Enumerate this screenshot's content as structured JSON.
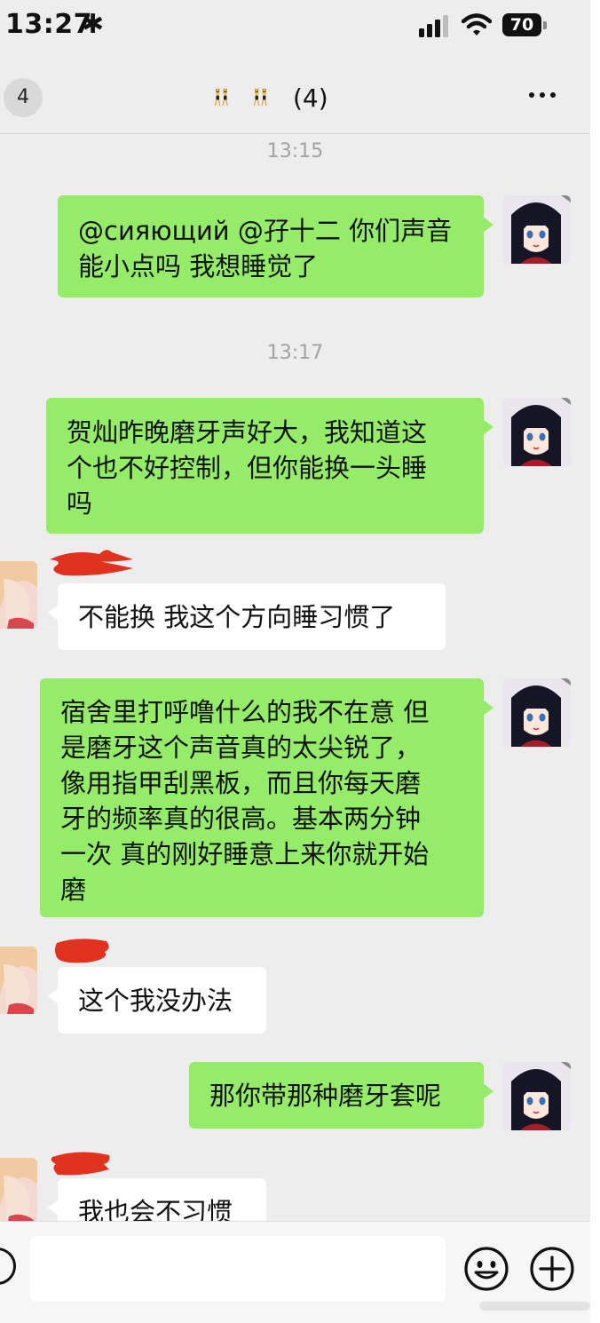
{
  "status_bar": {
    "time": "13:27",
    "battery": "70"
  },
  "nav": {
    "badge": "4",
    "title_count": "(4)"
  },
  "messages": [
    {
      "sender": "me",
      "lines": [
        "@сияющий @孖十二 你们声音",
        "能小点吗 我想睡觉了"
      ]
    },
    {
      "sender": "me",
      "lines": [
        "贺灿昨晚磨牙声好大，我知道这",
        "个也不好控制，但你能换一头睡",
        "吗"
      ]
    },
    {
      "sender": "other",
      "lines": [
        "不能换 我这个方向睡习惯了"
      ]
    },
    {
      "sender": "me",
      "lines": [
        "宿舍里打呼噜什么的我不在意 但",
        "是磨牙这个声音真的太尖锐了，",
        "像用指甲刮黑板，而且你每天磨",
        "牙的频率真的很高。基本两分钟",
        "一次 真的刚好睡意上来你就开始",
        "磨"
      ]
    },
    {
      "sender": "other",
      "lines": [
        "这个我没办法"
      ]
    },
    {
      "sender": "me",
      "lines": [
        "那你带那种磨牙套呢"
      ]
    },
    {
      "sender": "other",
      "lines": [
        "我也会不习惯"
      ]
    }
  ],
  "timestamps": [
    "13:15",
    "13:17"
  ],
  "icons": [
    "asterisk-icon",
    "signal-icon",
    "wifi-icon",
    "battery-icon",
    "more-icon",
    "voice-icon",
    "emoji-icon",
    "plus-icon"
  ],
  "colors": {
    "my_bubble": "#95ec69",
    "their_bubble": "#ffffff",
    "background": "#ededed",
    "redaction": "#e0321e"
  }
}
